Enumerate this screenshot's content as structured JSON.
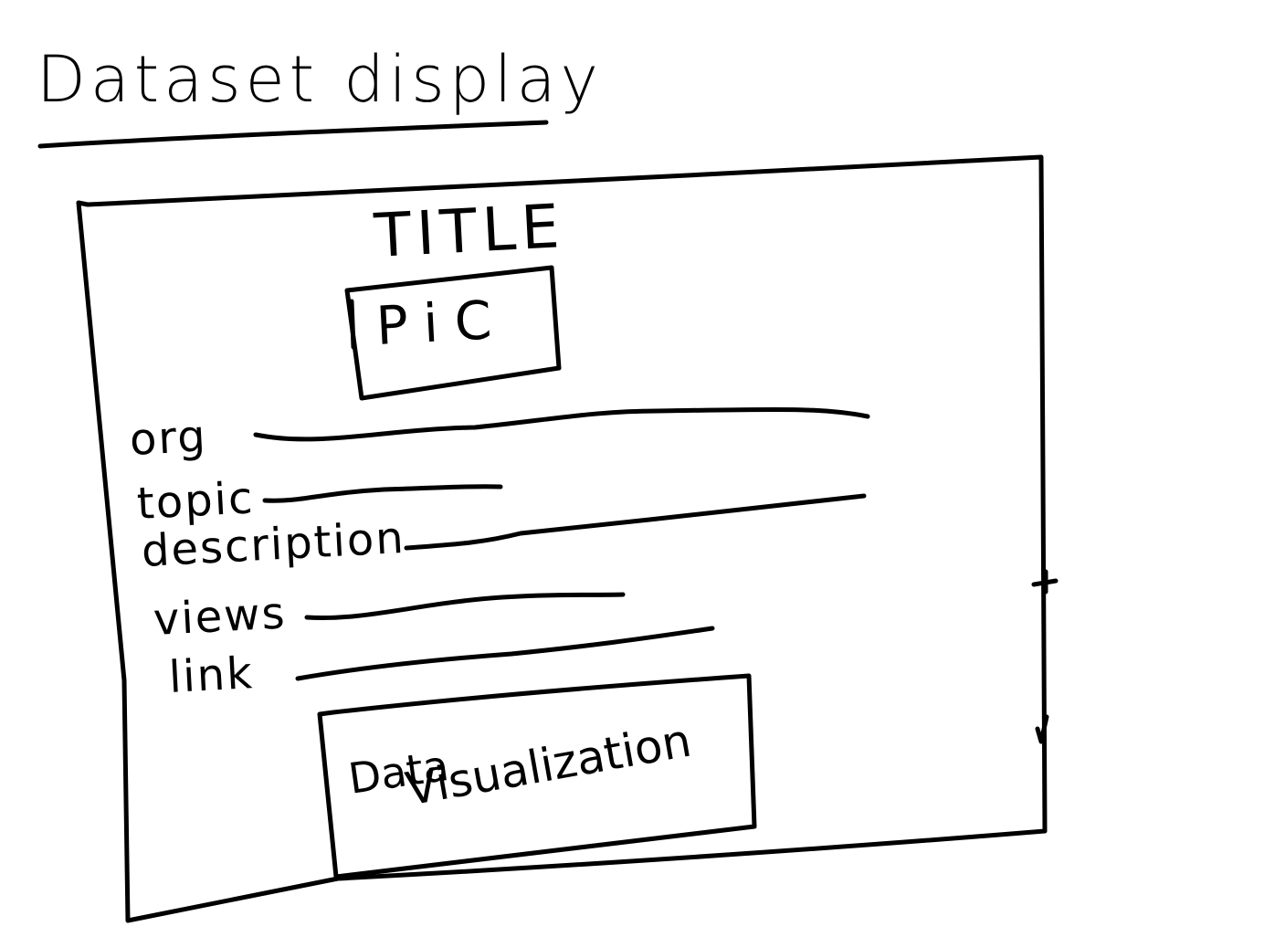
{
  "heading": "Dataset display",
  "card": {
    "title": "TITLE",
    "pic": "PiC",
    "fields": [
      {
        "label": "org"
      },
      {
        "label": "topic"
      },
      {
        "label": "description"
      },
      {
        "label": "views"
      },
      {
        "label": "link"
      }
    ],
    "visualization": {
      "line1": "Data",
      "line2": "Visualization"
    }
  },
  "colors": {
    "ink": "#000000",
    "paper": "#ffffff"
  }
}
